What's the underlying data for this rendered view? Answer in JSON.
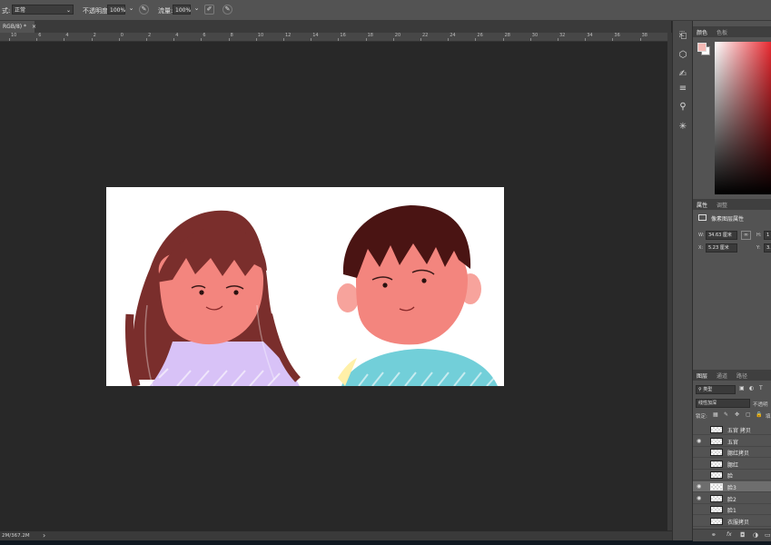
{
  "options_bar": {
    "mode_label": "式:",
    "mode_value": "正常",
    "opacity_label": "不透明度:",
    "opacity_value": "100%",
    "flow_label": "流量:",
    "flow_value": "100%"
  },
  "document_tab": {
    "label": "RGB/8) *",
    "close": "×"
  },
  "ruler_ticks": [
    "10",
    "6",
    "4",
    "2",
    "0",
    "2",
    "4",
    "6",
    "8",
    "10",
    "12",
    "14",
    "16",
    "18",
    "20",
    "22",
    "24",
    "26",
    "28",
    "30",
    "32",
    "34",
    "36",
    "38"
  ],
  "status_bar": {
    "doc_size": "2M/367.2M",
    "arrow": "›"
  },
  "tool_icons": [
    "history-icon",
    "3d-cube-icon",
    "brush-tool-icon",
    "adjust-sliders-icon",
    "clone-source-icon",
    "gear-settings-icon"
  ],
  "color_panel": {
    "tabs": [
      "颜色",
      "色板"
    ],
    "foreground": "#f4b9b4",
    "background": "#ffffff",
    "hue_color": "#e8272e"
  },
  "properties_panel": {
    "tabs": [
      "属性",
      "调整"
    ],
    "type_label": "像素图层属性",
    "w_label": "W:",
    "w_value": "34.63 厘米",
    "link_icon": "∞",
    "h_label": "H:",
    "h_value": "1",
    "x_label": "X:",
    "x_value": "5.23 厘米",
    "y_label": "Y:",
    "y_value": "3."
  },
  "layers_panel": {
    "tabs": [
      "图层",
      "通道",
      "路径"
    ],
    "filter_label": "类型",
    "blend_mode": "线性加深",
    "opacity_label": "不透明",
    "lock_label": "锁定:",
    "fill_label": "填",
    "layers": [
      {
        "name": "五官 拷贝",
        "visible": false,
        "selected": false
      },
      {
        "name": "五官",
        "visible": true,
        "selected": false
      },
      {
        "name": "腮红拷贝",
        "visible": false,
        "selected": false
      },
      {
        "name": "腮红",
        "visible": false,
        "selected": false
      },
      {
        "name": "脸",
        "visible": false,
        "selected": false
      },
      {
        "name": "脸3",
        "visible": true,
        "selected": true
      },
      {
        "name": "脸2",
        "visible": true,
        "selected": false
      },
      {
        "name": "脸1",
        "visible": false,
        "selected": false
      },
      {
        "name": "衣服拷贝",
        "visible": false,
        "selected": false
      }
    ],
    "footer_icons": [
      "link-layers-icon",
      "fx-icon",
      "mask-icon",
      "adjustment-icon",
      "folder-icon"
    ]
  },
  "colors": {
    "workspace": "#282828",
    "panel": "#535353",
    "skin": "#f3857e",
    "girl_hair": "#7a2e2c",
    "boy_hair": "#4a1413",
    "girl_sweater": "#d8c2f7",
    "boy_sweater": "#72cfd9"
  }
}
